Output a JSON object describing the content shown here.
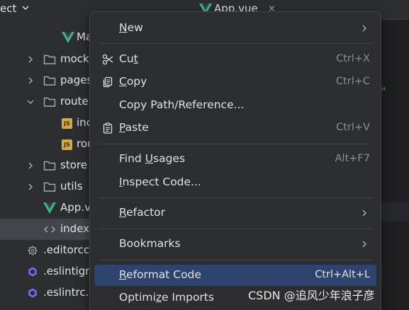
{
  "project": {
    "title": "ect",
    "tree": [
      {
        "name": "Ma",
        "type": "vue"
      },
      {
        "name": "mock",
        "type": "folder",
        "state": "collapsed"
      },
      {
        "name": "pages",
        "type": "folder",
        "state": "collapsed"
      },
      {
        "name": "route",
        "type": "folder",
        "state": "expanded"
      },
      {
        "name": "inc",
        "type": "js",
        "badge": "JS"
      },
      {
        "name": "rou",
        "type": "js",
        "badge": "JS"
      },
      {
        "name": "store",
        "type": "folder",
        "state": "collapsed"
      },
      {
        "name": "utils",
        "type": "folder",
        "state": "collapsed"
      },
      {
        "name": "App.v",
        "type": "vue"
      },
      {
        "name": "index",
        "type": "html",
        "selected": true
      },
      {
        "name": ".editorcc",
        "type": "gear"
      },
      {
        "name": ".eslintign",
        "type": "eslint"
      },
      {
        "name": ".eslintrc.",
        "type": "eslint"
      }
    ]
  },
  "editor": {
    "tab_label": "App.vue",
    "tab_close": "×",
    "code_fragment": "\""
  },
  "menu": {
    "items": [
      {
        "label": "New",
        "mnemonic": "N",
        "shortcut": "",
        "submenu": true,
        "icon": ""
      },
      {
        "label": "Cut",
        "mnemonic": "t",
        "shortcut": "Ctrl+X",
        "submenu": false,
        "icon": "scissors-icon"
      },
      {
        "label": "Copy",
        "mnemonic": "C",
        "shortcut": "Ctrl+C",
        "submenu": false,
        "icon": "copy-icon"
      },
      {
        "label": "Copy Path/Reference...",
        "mnemonic": "",
        "shortcut": "",
        "submenu": false,
        "icon": ""
      },
      {
        "label": "Paste",
        "mnemonic": "P",
        "shortcut": "Ctrl+V",
        "submenu": false,
        "icon": "clipboard-icon"
      },
      {
        "label": "Find Usages",
        "mnemonic": "U",
        "shortcut": "Alt+F7",
        "submenu": false,
        "icon": ""
      },
      {
        "label": "Inspect Code...",
        "mnemonic": "I",
        "shortcut": "",
        "submenu": false,
        "icon": ""
      },
      {
        "label": "Refactor",
        "mnemonic": "R",
        "shortcut": "",
        "submenu": true,
        "icon": ""
      },
      {
        "label": "Bookmarks",
        "mnemonic": "",
        "shortcut": "",
        "submenu": true,
        "icon": ""
      },
      {
        "label": "Reformat Code",
        "mnemonic": "R",
        "shortcut": "Ctrl+Alt+L",
        "submenu": false,
        "icon": "",
        "highlighted": true
      },
      {
        "label": "Optimize Imports",
        "mnemonic": "z",
        "shortcut": "",
        "submenu": false,
        "icon": ""
      }
    ]
  },
  "watermark": "CSDN @追风少年浪子彦",
  "colors": {
    "vue_green": "#41b883",
    "eslint_purple": "#6f6df0",
    "js_badge": "#d8a93c",
    "highlight": "#2e436e"
  }
}
